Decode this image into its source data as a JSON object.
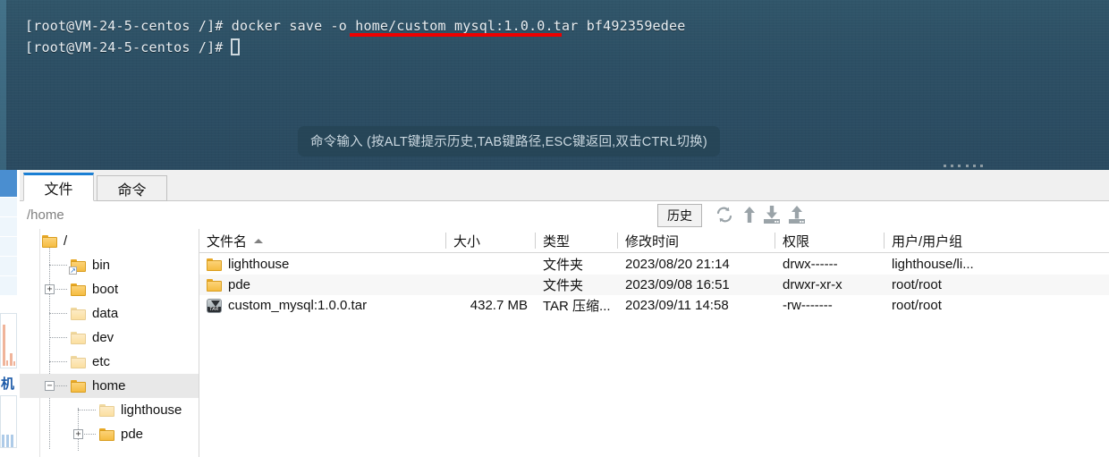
{
  "terminal": {
    "line1_prefix": "[root@VM-24-5-centos /]# docker save -o ",
    "line1_highlighted": "home/custom_mysql:1.0.0.tar",
    "line1_suffix": " bf492359edee",
    "line2": "[root@VM-24-5-centos /]# ",
    "hint": "命令输入 (按ALT键提示历史,TAB键路径,ESC键返回,双击CTRL切换)",
    "background_color": "#2b4e64",
    "underline_color": "#ee0000",
    "text_color": "#e8eef2"
  },
  "tabs": [
    {
      "label": "文件",
      "active": true
    },
    {
      "label": "命令",
      "active": false
    }
  ],
  "toolbar": {
    "path_value": "/home",
    "path_placeholder": "/home",
    "history_label": "历史",
    "icons": [
      {
        "name": "refresh-icon",
        "title": "refresh"
      },
      {
        "name": "parent-dir-icon",
        "title": "up"
      },
      {
        "name": "download-icon",
        "title": "download"
      },
      {
        "name": "upload-icon",
        "title": "upload"
      }
    ]
  },
  "tree": {
    "items": [
      {
        "label": "/",
        "depth": 0,
        "expander": "",
        "selected": false,
        "shortcut": false,
        "pale": false
      },
      {
        "label": "bin",
        "depth": 1,
        "expander": "",
        "selected": false,
        "shortcut": true,
        "pale": false
      },
      {
        "label": "boot",
        "depth": 1,
        "expander": "+",
        "selected": false,
        "shortcut": false,
        "pale": false
      },
      {
        "label": "data",
        "depth": 1,
        "expander": "",
        "selected": false,
        "shortcut": false,
        "pale": true
      },
      {
        "label": "dev",
        "depth": 1,
        "expander": "",
        "selected": false,
        "shortcut": false,
        "pale": true
      },
      {
        "label": "etc",
        "depth": 1,
        "expander": "",
        "selected": false,
        "shortcut": false,
        "pale": true
      },
      {
        "label": "home",
        "depth": 1,
        "expander": "−",
        "selected": true,
        "shortcut": false,
        "pale": false
      },
      {
        "label": "lighthouse",
        "depth": 2,
        "expander": "",
        "selected": false,
        "shortcut": false,
        "pale": true
      },
      {
        "label": "pde",
        "depth": 2,
        "expander": "+",
        "selected": false,
        "shortcut": false,
        "pale": false
      }
    ]
  },
  "file_list": {
    "columns": [
      {
        "label": "文件名",
        "sorted": "asc"
      },
      {
        "label": "大小",
        "sorted": ""
      },
      {
        "label": "类型",
        "sorted": ""
      },
      {
        "label": "修改时间",
        "sorted": ""
      },
      {
        "label": "权限",
        "sorted": ""
      },
      {
        "label": "用户/用户组",
        "sorted": ""
      }
    ],
    "rows": [
      {
        "icon": "folder-icon",
        "name": "lighthouse",
        "size": "",
        "type": "文件夹",
        "modified": "2023/08/20 21:14",
        "permissions": "drwx------",
        "owner": "lighthouse/li..."
      },
      {
        "icon": "folder-icon",
        "name": "pde",
        "size": "",
        "type": "文件夹",
        "modified": "2023/09/08 16:51",
        "permissions": "drwxr-xr-x",
        "owner": "root/root"
      },
      {
        "icon": "tar-file-icon",
        "name": "custom_mysql:1.0.0.tar",
        "size": "432.7 MB",
        "type": "TAR 压缩...",
        "modified": "2023/09/11 14:58",
        "permissions": "-rw-------",
        "owner": "root/root"
      }
    ]
  },
  "background_app": {
    "label": "机"
  }
}
